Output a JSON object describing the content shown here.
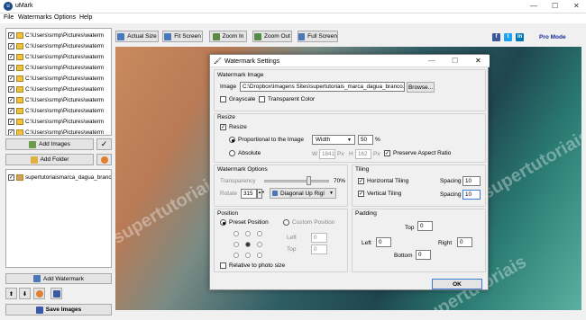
{
  "window": {
    "title": "uMark",
    "minimize": "—",
    "maximize": "☐",
    "close": "✕"
  },
  "menu": [
    "File",
    "Watermarks",
    "Options",
    "Help"
  ],
  "toolbar": {
    "actual_size": "Actual Size",
    "fit_screen": "Fit Screen",
    "zoom_in": "Zoom In",
    "zoom_out": "Zoom Out",
    "full_screen": "Full Screen",
    "pro_mode": "Pro Mode",
    "social": [
      "f",
      "t",
      "in"
    ]
  },
  "files": [
    "C:\\Users\\srmp\\Pictures\\waterm",
    "C:\\Users\\srmp\\Pictures\\waterm",
    "C:\\Users\\srmp\\Pictures\\waterm",
    "C:\\Users\\srmp\\Pictures\\waterm",
    "C:\\Users\\srmp\\Pictures\\waterm",
    "C:\\Users\\srmp\\Pictures\\waterm",
    "C:\\Users\\srmp\\Pictures\\waterm",
    "C:\\Users\\srmp\\Pictures\\waterm",
    "C:\\Users\\srmp\\Pictures\\waterm",
    "C:\\Users\\srmp\\Pictures\\waterm"
  ],
  "left": {
    "add_images": "Add Images",
    "add_folder": "Add Folder",
    "watermark_item": "supertutoriaismarca_dagua_branc",
    "add_watermark": "Add Watermark",
    "save_images": "Save Images"
  },
  "preview": {
    "watermark_text": "supertutoriais"
  },
  "dialog": {
    "title": "Watermark Settings",
    "watermark_image": {
      "section": "Watermark Image",
      "image_label": "Image",
      "image_path": "C:\\Dropbox\\Imagens Sites\\supertutoriais_marca_dagua_branco.pn",
      "browse": "Browse...",
      "grayscale": "Grayscale",
      "transparent_color": "Transparent Color"
    },
    "resize": {
      "section": "Resize",
      "resize": "Resize",
      "proportional": "Proportional to the Image",
      "dimension": "Width",
      "percent": "50",
      "percent_unit": "%",
      "absolute": "Absolute",
      "w_label": "W",
      "w_value": "1841",
      "px1": "Px",
      "h_label": "H",
      "h_value": "162",
      "px2": "Px",
      "preserve": "Preserve Aspect Ratio"
    },
    "options": {
      "section": "Watermark Options",
      "transparency": "Transparency",
      "transparency_value": "70%",
      "transparency_level": 0.7,
      "rotate": "Rotate",
      "rotate_value": "315",
      "rotate_preset": "Diagonal Up Rigl"
    },
    "tiling": {
      "section": "Tiling",
      "horizontal": "Horizontal Tiling",
      "vertical": "Vertical Tiling",
      "spacing": "Spacing",
      "h_spacing": "10",
      "v_spacing": "10"
    },
    "position": {
      "section": "Position",
      "preset": "Preset Position",
      "custom": "Custom Position",
      "left": "Left",
      "left_value": "0",
      "top": "Top",
      "top_value": "0",
      "relative": "Relative to photo size"
    },
    "padding": {
      "section": "Padding",
      "top": "Top",
      "top_value": "0",
      "left": "Left",
      "left_value": "0",
      "right": "Right",
      "right_value": "0",
      "bottom": "Bottom",
      "bottom_value": "0"
    },
    "ok": "OK"
  }
}
